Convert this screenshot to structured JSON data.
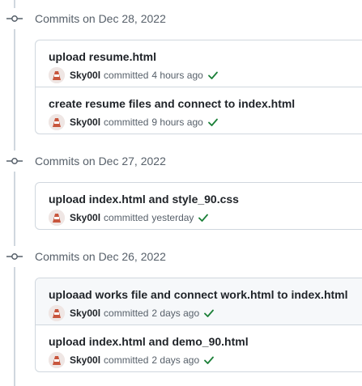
{
  "colors": {
    "accent_success": "#1a7f37",
    "border": "#d0d7de",
    "muted_text": "#57606a",
    "text": "#1f2328"
  },
  "committed_word": "committed",
  "groups": [
    {
      "title": "Commits on Dec 28, 2022",
      "commits": [
        {
          "message": "upload resume.html",
          "author": "Sky00l",
          "time": "4 hours ago",
          "status_icon": "check-icon"
        },
        {
          "message": "create resume files and connect to index.html",
          "author": "Sky00l",
          "time": "9 hours ago",
          "status_icon": "check-icon"
        }
      ]
    },
    {
      "title": "Commits on Dec 27, 2022",
      "commits": [
        {
          "message": "upload index.html and style_90.css",
          "author": "Sky00l",
          "time": "yesterday",
          "status_icon": "check-icon"
        }
      ]
    },
    {
      "title": "Commits on Dec 26, 2022",
      "commits": [
        {
          "message": "uploaad works file and connect work.html to index.html",
          "author": "Sky00l",
          "time": "2 days ago",
          "status_icon": "check-icon",
          "hovered": true
        },
        {
          "message": "upload index.html and demo_90.html",
          "author": "Sky00l",
          "time": "2 days ago",
          "status_icon": "check-icon"
        }
      ]
    }
  ]
}
